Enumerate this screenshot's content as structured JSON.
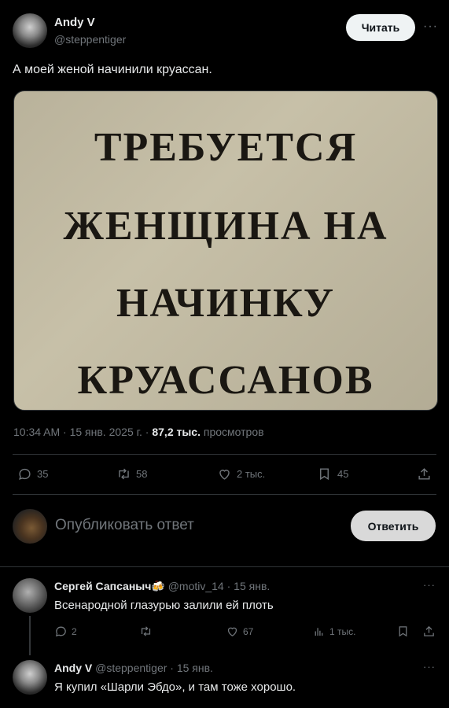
{
  "tweet": {
    "author_name": "Andy V",
    "author_handle": "@steppentiger",
    "read_button": "Читать",
    "more": "···",
    "text": "А моей женой начинили круассан.",
    "image_lines": [
      "ТРЕБУЕТСЯ",
      "ЖЕНЩИНА НА",
      "НАЧИНКУ",
      "КРУАССАНОВ"
    ],
    "time": "10:34 AM · 15 янв. 2025 г. · ",
    "views_count": "87,2 тыс.",
    "views_label": " просмотров"
  },
  "actions": {
    "replies": "35",
    "retweets": "58",
    "likes": "2 тыс.",
    "bookmarks": "45"
  },
  "reply_box": {
    "placeholder": "Опубликовать ответ",
    "button": "Ответить"
  },
  "replies": [
    {
      "name": "Сергей Сапсаныч",
      "emoji": "🍻",
      "handle": "@motiv_14",
      "date": "· 15 янв.",
      "text": "Всенародной глазурью залили ей плоть",
      "replies": "2",
      "retweets": "",
      "likes": "67",
      "views": "1 тыс.",
      "more": "···"
    },
    {
      "name": "Andy V",
      "handle": "@steppentiger",
      "date": "· 15 янв.",
      "text": "Я купил «Шарли Эбдо», и там тоже хорошо.",
      "more": "···"
    }
  ]
}
